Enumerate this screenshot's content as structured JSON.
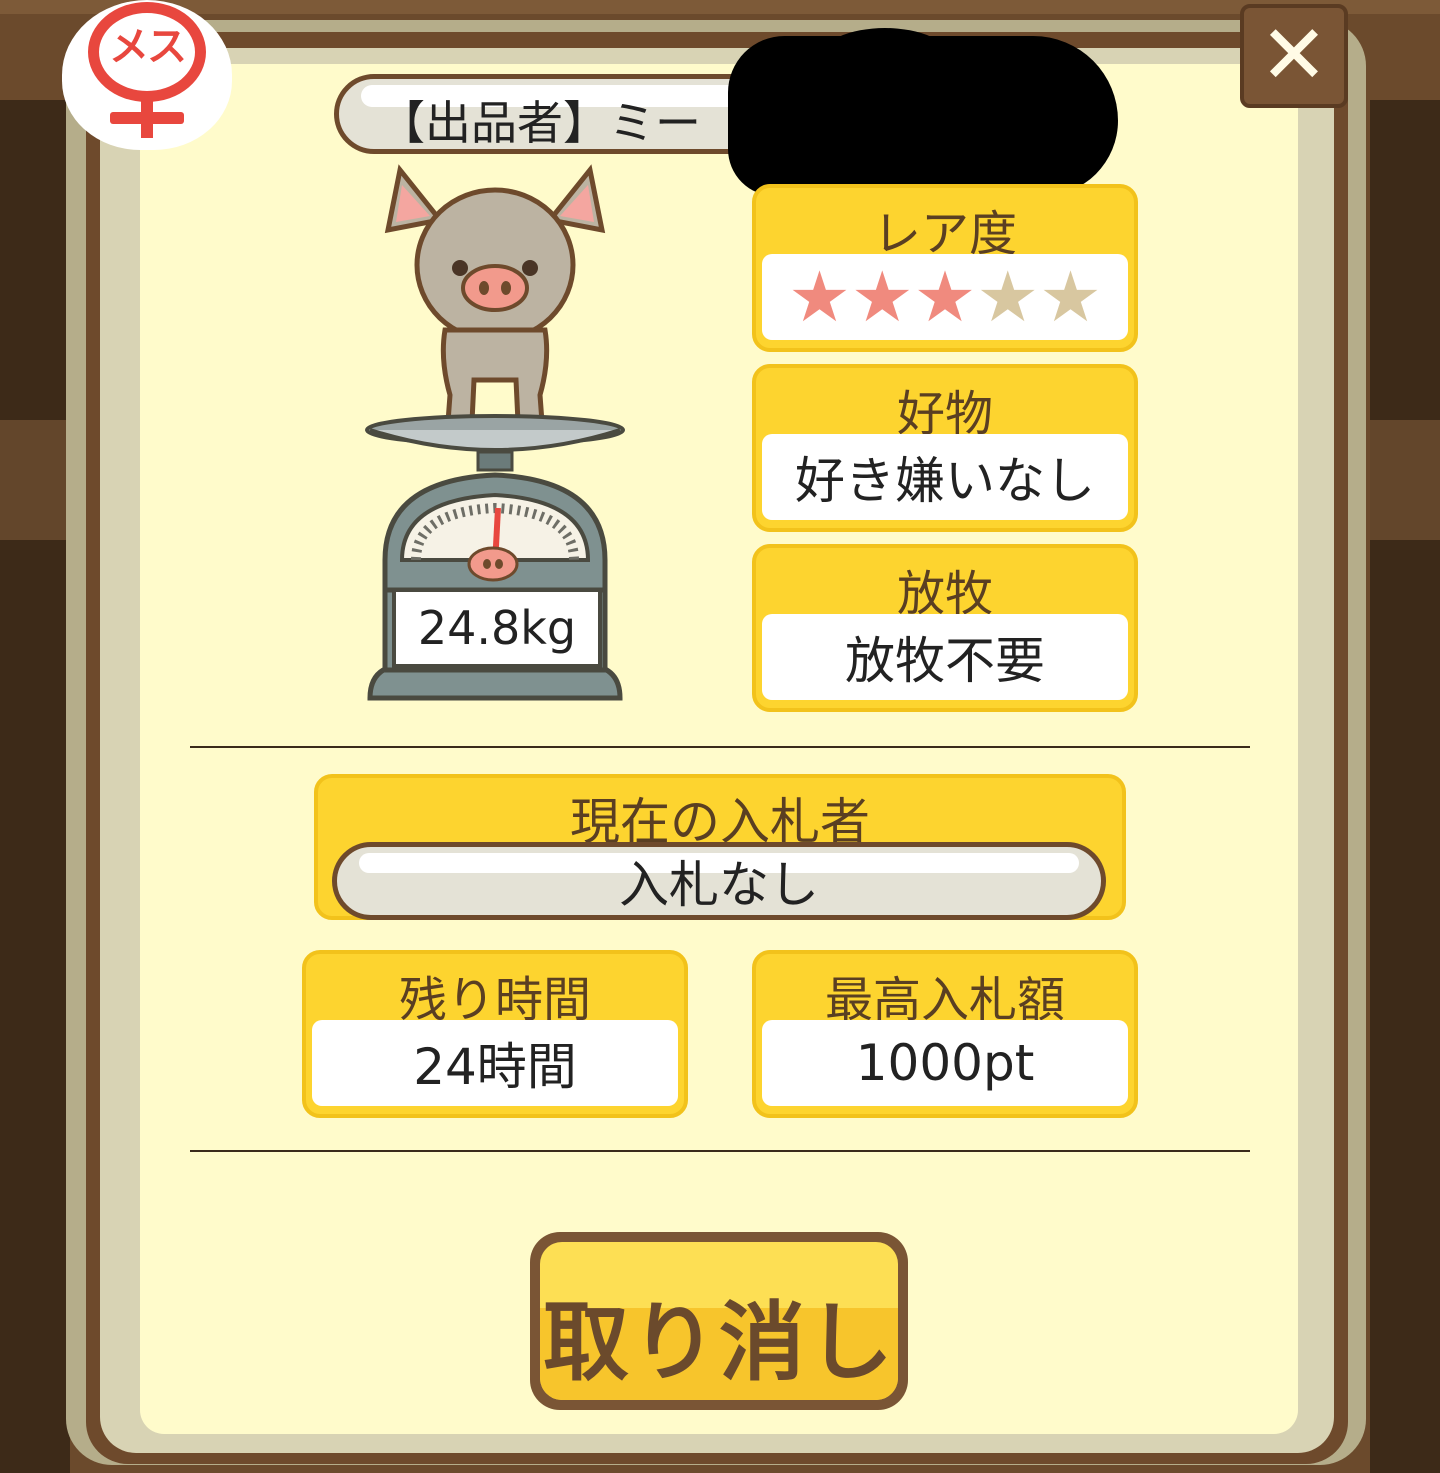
{
  "badge": {
    "gender_label": "メス"
  },
  "close": {
    "symbol": "✕"
  },
  "seller": {
    "text": "【出品者】ミー"
  },
  "animal": {
    "weight": "24.8kg"
  },
  "rarity": {
    "label": "レア度",
    "stars_filled": 3,
    "stars_total": 5,
    "filled_color": "#f08a7e",
    "empty_color": "#d8c7a0"
  },
  "food": {
    "label": "好物",
    "value": "好き嫌いなし"
  },
  "grazing": {
    "label": "放牧",
    "value": "放牧不要"
  },
  "bidder": {
    "label": "現在の入札者",
    "value": "入札なし"
  },
  "time_left": {
    "label": "残り時間",
    "value": "24時間"
  },
  "max_bid": {
    "label": "最高入札額",
    "value": "1000pt"
  },
  "actions": {
    "cancel_label": "取り消し"
  }
}
